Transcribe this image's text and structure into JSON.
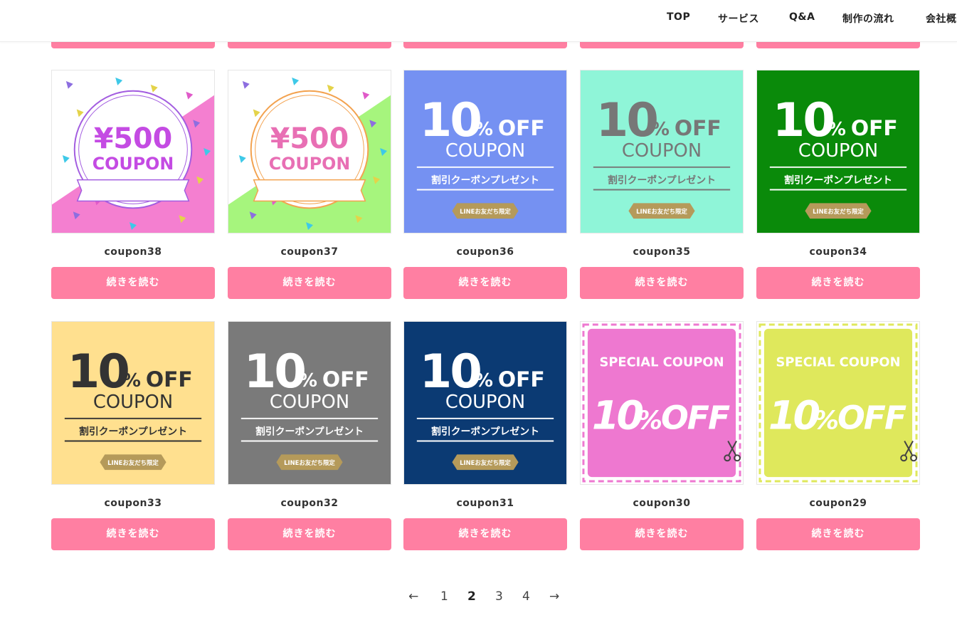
{
  "nav": {
    "items": [
      "TOP",
      "サービス",
      "Q&A",
      "制作の流れ",
      "会社概要"
    ]
  },
  "posts": [
    {
      "title": "coupon38",
      "button": "続きを読む",
      "thumb": {
        "type": "yen",
        "bg": "#f47fd0",
        "line": "#a35de0",
        "text": "#c44be3",
        "amount": "¥500",
        "label": "COUPON"
      }
    },
    {
      "title": "coupon37",
      "button": "続きを読む",
      "thumb": {
        "type": "yen",
        "bg": "#a6f57d",
        "line": "#f3a24f",
        "text": "#e86fb4",
        "amount": "¥500",
        "label": "COUPON"
      }
    },
    {
      "title": "coupon36",
      "button": "続きを読む",
      "thumb": {
        "type": "off",
        "bg": "#7591f2",
        "text": "#ffffff",
        "big": "10",
        "pct": "%",
        "off": "OFF",
        "label": "COUPON",
        "sub": "割引クーポンプレゼント",
        "badge": "LINEお友だち限定"
      }
    },
    {
      "title": "coupon35",
      "button": "続きを読む",
      "thumb": {
        "type": "off",
        "bg": "#8ff5d8",
        "text": "#777777",
        "big": "10",
        "pct": "%",
        "off": "OFF",
        "label": "COUPON",
        "sub": "割引クーポンプレゼント",
        "badge": "LINEお友だち限定"
      }
    },
    {
      "title": "coupon34",
      "button": "続きを読む",
      "thumb": {
        "type": "off",
        "bg": "#0a8a0a",
        "text": "#ffffff",
        "big": "10",
        "pct": "%",
        "off": "OFF",
        "label": "COUPON",
        "sub": "割引クーポンプレゼント",
        "badge": "LINEお友だち限定"
      }
    },
    {
      "title": "coupon33",
      "button": "続きを読む",
      "thumb": {
        "type": "off",
        "bg": "#ffe08f",
        "text": "#333333",
        "big": "10",
        "pct": "%",
        "off": "OFF",
        "label": "COUPON",
        "sub": "割引クーポンプレゼント",
        "badge": "LINEお友だち限定"
      }
    },
    {
      "title": "coupon32",
      "button": "続きを読む",
      "thumb": {
        "type": "off",
        "bg": "#7a7a7a",
        "text": "#ffffff",
        "big": "10",
        "pct": "%",
        "off": "OFF",
        "label": "COUPON",
        "sub": "割引クーポンプレゼント",
        "badge": "LINEお友だち限定"
      }
    },
    {
      "title": "coupon31",
      "button": "続きを読む",
      "thumb": {
        "type": "off",
        "bg": "#0b3a73",
        "text": "#ffffff",
        "big": "10",
        "pct": "%",
        "off": "OFF",
        "label": "COUPON",
        "sub": "割引クーポンプレゼント",
        "badge": "LINEお友だち限定"
      }
    },
    {
      "title": "coupon30",
      "button": "続きを読む",
      "thumb": {
        "type": "special",
        "bg": "#ee78d0",
        "dash": "#ee78d0",
        "text": "#ffffff",
        "head": "SPECIAL COUPON",
        "big": "10",
        "pct": "%",
        "off": "OFF"
      }
    },
    {
      "title": "coupon29",
      "button": "続きを読む",
      "thumb": {
        "type": "special",
        "bg": "#dfe85c",
        "dash": "#dfe85c",
        "text": "#ffffff",
        "head": "SPECIAL COUPON",
        "big": "10",
        "pct": "%",
        "off": "OFF"
      }
    }
  ],
  "pagination": {
    "prev": "←",
    "pages": [
      "1",
      "2",
      "3",
      "4"
    ],
    "current": "2",
    "next": "→"
  },
  "colors": {
    "accent": "#ff7fa2",
    "badge": "#b59a5a"
  }
}
